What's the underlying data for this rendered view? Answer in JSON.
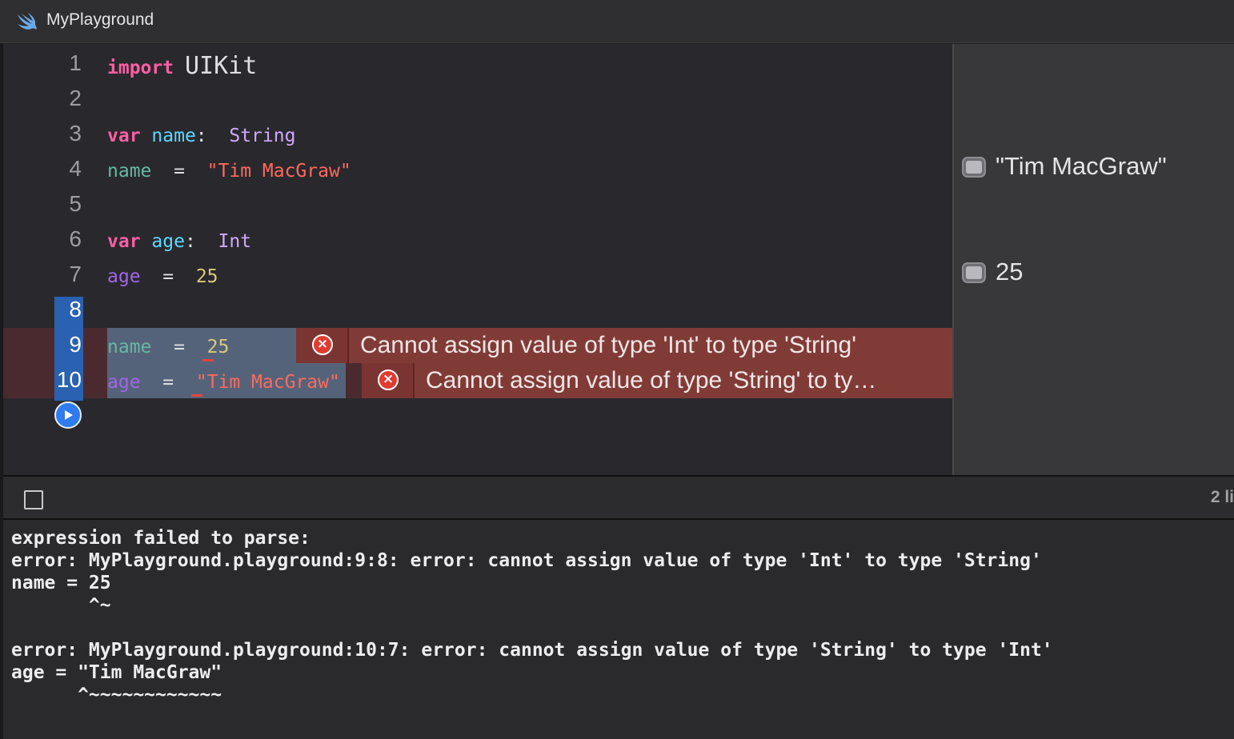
{
  "window": {
    "title": "MyPlayground",
    "icon": "swift-icon"
  },
  "editor": {
    "line_numbers": [
      "1",
      "2",
      "3",
      "4",
      "5",
      "6",
      "7",
      "8",
      "9",
      "10"
    ],
    "lines": {
      "l1": {
        "kw": "import",
        "name": "UIKit"
      },
      "l3": {
        "kw": "var",
        "name": "name",
        "colon": ":",
        "type": "String"
      },
      "l4": {
        "name": "name",
        "op": "=",
        "value": "\"Tim MacGraw\""
      },
      "l6": {
        "kw": "var",
        "name": "age",
        "colon": ":",
        "type": "Int"
      },
      "l7": {
        "name": "age",
        "op": "=",
        "value": "25"
      },
      "l9": {
        "name": "name",
        "op": "=",
        "value": "25"
      },
      "l10": {
        "name": "age",
        "op": "=",
        "value": "\"Tim MacGraw\""
      }
    },
    "errors": [
      {
        "line": "9",
        "message": "Cannot assign value of type 'Int' to type 'String'"
      },
      {
        "line": "10",
        "message": "Cannot assign value of type 'String' to ty…"
      }
    ],
    "run_button_icon": "play-icon"
  },
  "results": {
    "items": [
      {
        "line": "4",
        "value": "\"Tim MacGraw\""
      },
      {
        "line": "7",
        "value": "25"
      }
    ]
  },
  "debug_bar": {
    "lines_label": "2 li"
  },
  "console": {
    "lines": [
      "expression failed to parse:",
      "error: MyPlayground.playground:9:8: error: cannot assign value of type 'Int' to type 'String'",
      "name = 25",
      "       ^~",
      "",
      "error: MyPlayground.playground:10:7: error: cannot assign value of type 'String' to type 'Int'",
      "age = \"Tim MacGraw\"",
      "      ^~~~~~~~~~~~~"
    ]
  },
  "colors": {
    "keyword": "#fc5fa3",
    "type": "#d0a8ff",
    "string": "#fc6a5d",
    "number": "#d9c97c",
    "error_bubble": "#813b37",
    "gutter_selection": "#2a61b0"
  }
}
